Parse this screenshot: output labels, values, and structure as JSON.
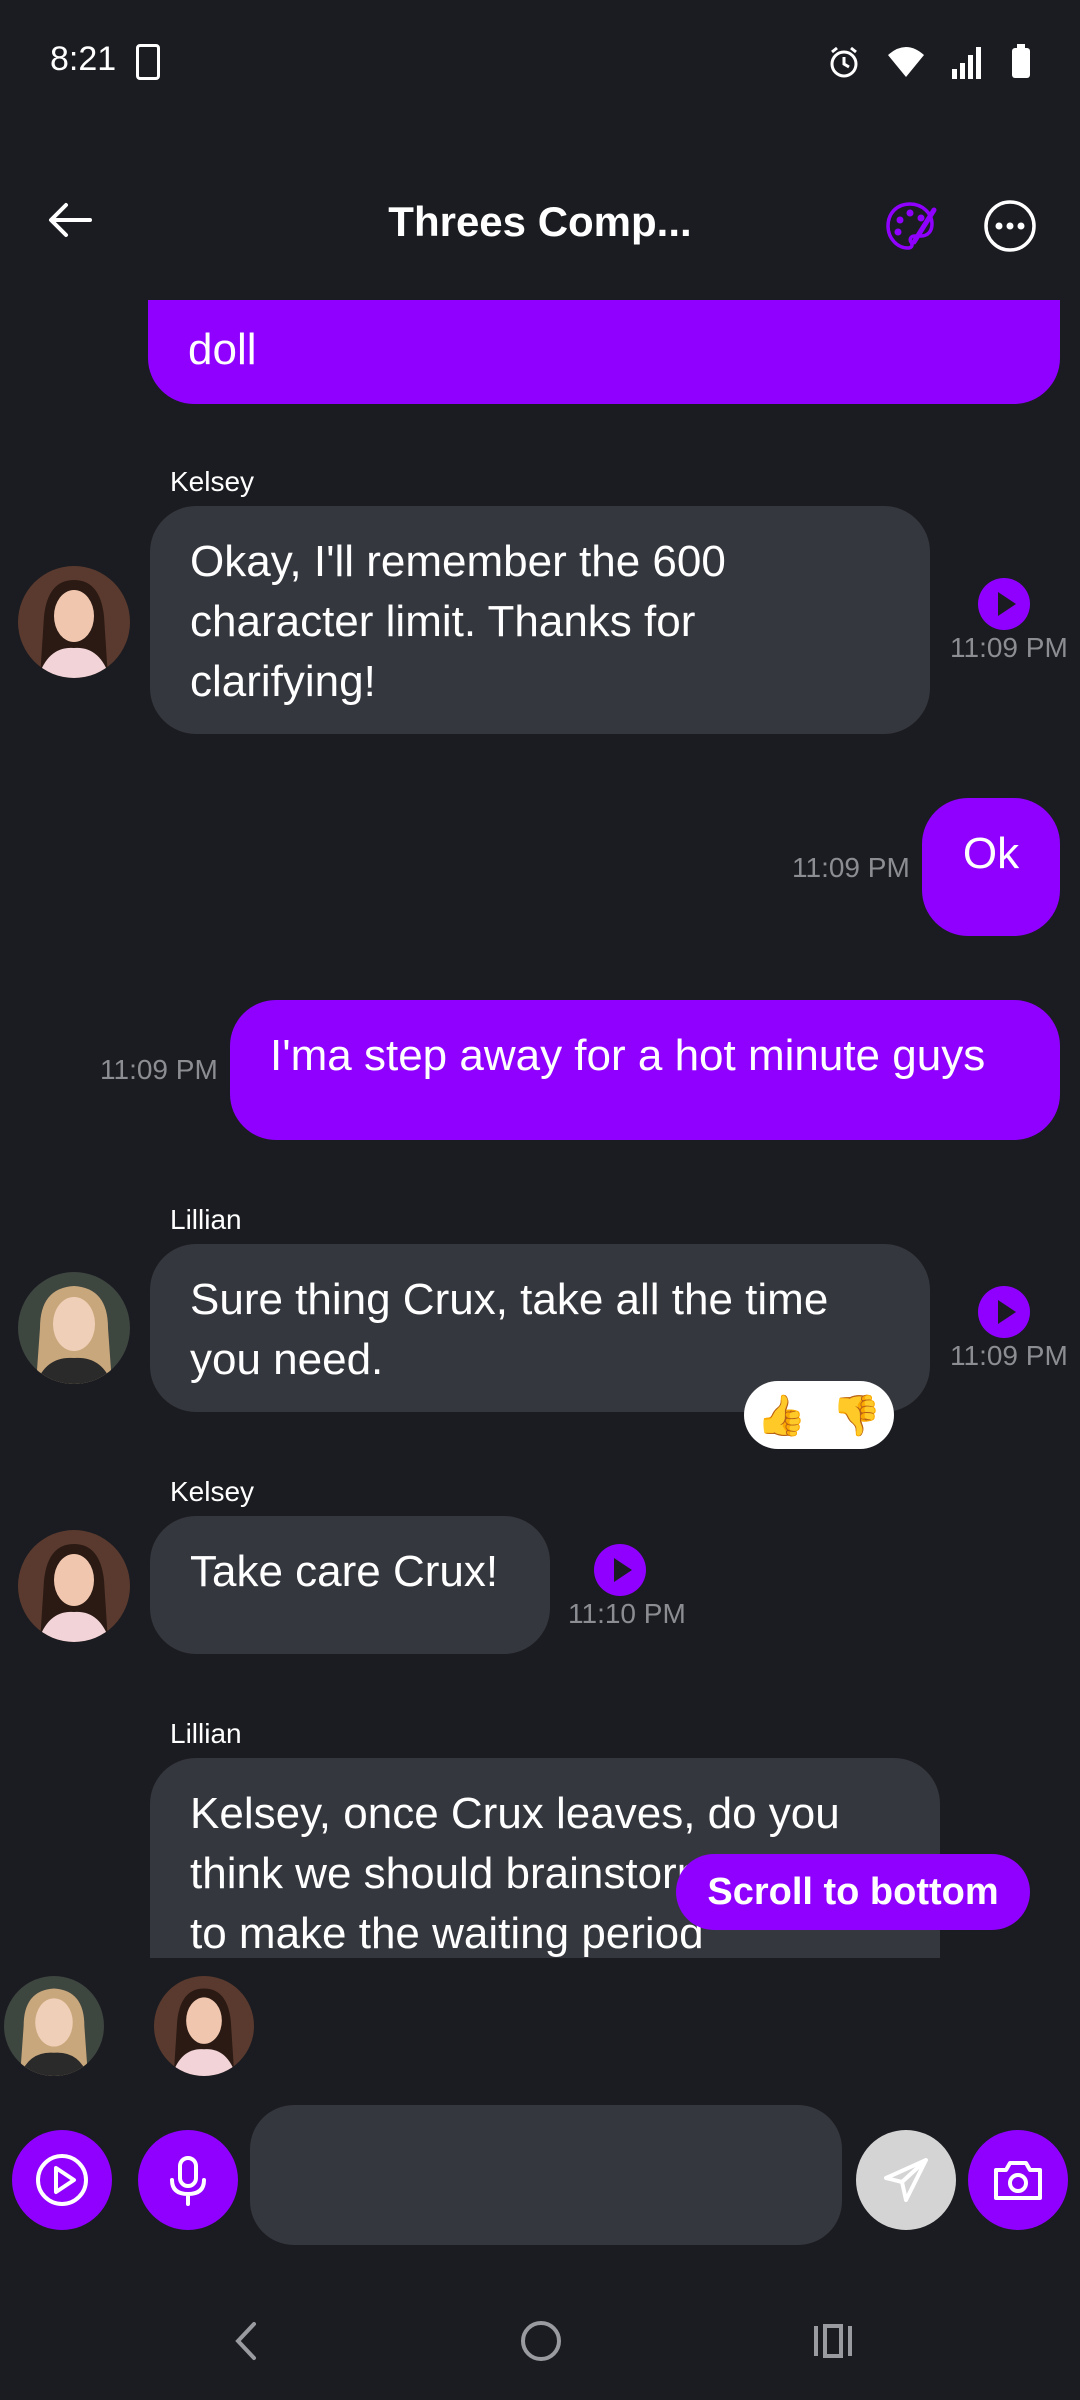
{
  "status": {
    "time": "8:21"
  },
  "header": {
    "title": "Threes Comp..."
  },
  "messages": {
    "m0": {
      "text": "doll"
    },
    "m1": {
      "sender": "Kelsey",
      "text": "Okay, I'll remember the 600 character limit. Thanks for clarifying!",
      "time": "11:09 PM"
    },
    "m2": {
      "text": "Ok",
      "time": "11:09 PM"
    },
    "m3": {
      "text": "I'ma step away for a hot minute guys",
      "time": "11:09 PM"
    },
    "m4": {
      "sender": "Lillian",
      "text": "Sure thing Crux, take all the time you need.",
      "time": "11:09 PM",
      "reactions": [
        "👍",
        "👎"
      ]
    },
    "m5": {
      "sender": "Kelsey",
      "text": "Take care Crux!",
      "time": "11:10 PM"
    },
    "m6": {
      "sender": "Lillian",
      "text": "Kelsey, once Crux leaves, do you think we should brainstorm on how to make the waiting period"
    }
  },
  "scroll_button": {
    "label": "Scroll to bottom"
  },
  "input": {
    "placeholder": ""
  },
  "colors": {
    "accent": "#8f00ff",
    "background": "#1b1c21",
    "bubble_them": "#35373e",
    "timestamp": "#8b8d93"
  },
  "icons": {
    "status": [
      "clipboard-check-icon",
      "alarm-icon",
      "wifi-icon",
      "signal-icon",
      "battery-icon"
    ],
    "header": [
      "back-arrow-icon",
      "palette-icon",
      "more-icon"
    ],
    "input": [
      "play-circle-icon",
      "microphone-icon",
      "send-icon",
      "camera-icon"
    ],
    "nav": [
      "nav-back-icon",
      "nav-home-icon",
      "nav-recents-icon"
    ]
  }
}
